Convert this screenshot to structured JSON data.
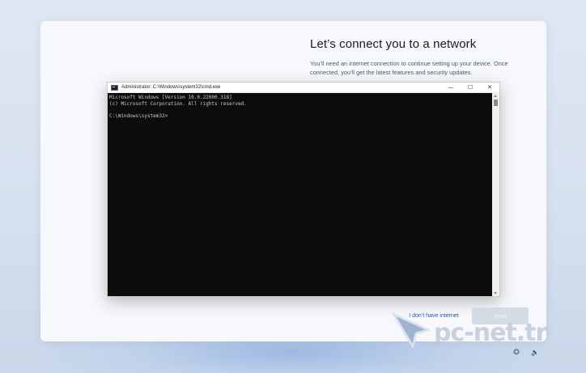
{
  "oobe": {
    "title": "Let’s connect you to a network",
    "subtitle": "You’ll need an internet connection to continue setting up your device. Once connected, you’ll get the latest features and security updates.",
    "no_internet_label": "I don’t have internet",
    "next_label": "Next"
  },
  "cmd": {
    "title": "Administrator: C:\\Windows\\system32\\cmd.exe",
    "icon": "cmd-icon",
    "controls": {
      "minimize": "—",
      "maximize": "☐",
      "close": "✕"
    },
    "lines": [
      "Microsoft Windows [Version 10.0.22000.318]",
      "(c) Microsoft Corporation. All rights reserved.",
      "",
      "C:\\Windows\\system32>"
    ]
  },
  "watermark": {
    "text": "pc-net.tr",
    "icon": "cursor-arrow-icon"
  },
  "tray": {
    "accessibility_icon": "accessibility-icon",
    "accessibility_glyph": "✪",
    "volume_icon": "volume-icon",
    "volume_glyph": "🔈"
  },
  "colors": {
    "background": "#d6e1ef",
    "panel": "#f6f8fb",
    "link": "#2a5aa0",
    "button_disabled": "#d3dbe5",
    "console_bg": "#0c0c0c",
    "console_text": "#cccccc"
  }
}
